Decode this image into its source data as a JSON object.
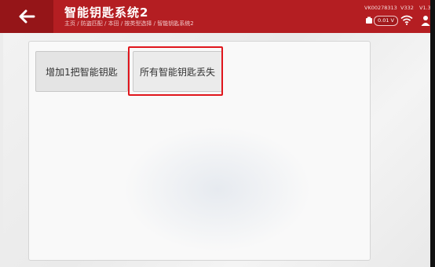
{
  "header": {
    "title": "智能钥匙系统2",
    "breadcrumb": "主页 / 防盗匹配 / 本田 / 按类型选择 / 智能钥匙系统2",
    "serial": "VK00278313",
    "version": "V332",
    "version2": "V1.3",
    "voltage": "0.01 V",
    "accent_color": "#b41e22"
  },
  "options": {
    "add_key": "增加1把智能钥匙",
    "all_keys_lost": "所有智能钥匙丢失"
  },
  "icons": {
    "back": "arrow-left-icon",
    "battery": "battery-icon",
    "wifi": "wifi-icon",
    "user": "user-icon"
  },
  "annotation": {
    "highlight_color": "#e0161c"
  }
}
